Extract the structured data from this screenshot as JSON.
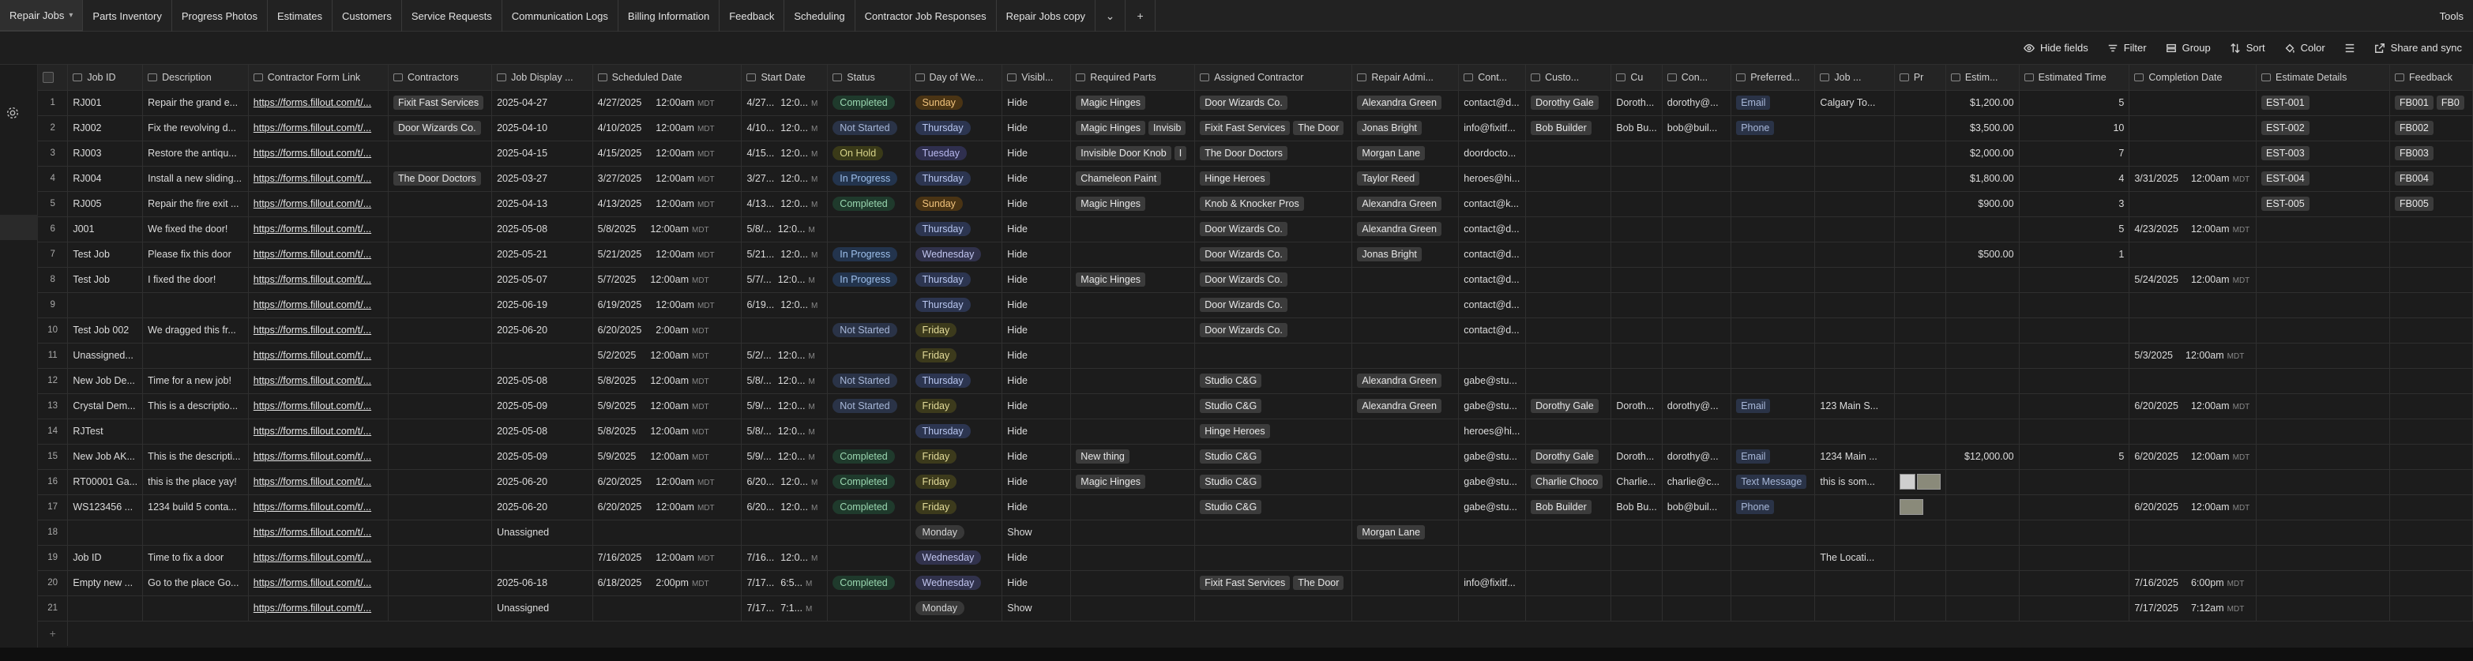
{
  "tabs": [
    "Repair Jobs",
    "Parts Inventory",
    "Progress Photos",
    "Estimates",
    "Customers",
    "Service Requests",
    "Communication Logs",
    "Billing Information",
    "Feedback",
    "Scheduling",
    "Contractor Job Responses",
    "Repair Jobs copy"
  ],
  "tools_label": "Tools",
  "toolbar": {
    "hide_fields": "Hide fields",
    "filter": "Filter",
    "group": "Group",
    "sort": "Sort",
    "color": "Color",
    "share": "Share and sync"
  },
  "columns": [
    "Job ID",
    "Description",
    "Contractor Form Link",
    "Contractors",
    "Job Display ...",
    "Scheduled Date",
    "Start Date",
    "Status",
    "Day of We...",
    "Visibl...",
    "Required Parts",
    "Assigned Contractor",
    "Repair Admi...",
    "Cont...",
    "Custo...",
    "Cu",
    "Con...",
    "Preferred...",
    "Job ...",
    "Pr",
    "Estim...",
    "Estimated Time",
    "Completion Date",
    "Estimate Details",
    "Feedback"
  ],
  "tz": "MDT",
  "add_row": "+",
  "rows": [
    {
      "n": "1",
      "id": "RJ001",
      "desc": "Repair the grand e...",
      "link": "https://forms.fillout.com/t/...",
      "contractors": [
        "Fixit Fast Services"
      ],
      "disp": "2025-04-27",
      "sd": "4/27/2025",
      "st": "12:00am",
      "stz": true,
      "sdd": "4/27...",
      "stt": "12:0...",
      "status": "Completed",
      "sc": "completed",
      "day": "Sunday",
      "dc": "sunday",
      "vis": "Hide",
      "parts": [
        "Magic Hinges"
      ],
      "ac": [
        "Door Wizards Co."
      ],
      "adm": [
        "Alexandra Green"
      ],
      "cont": "contact@d...",
      "cust": [
        "Dorothy Gale"
      ],
      "cu": "Doroth...",
      "con": "dorothy@...",
      "pref": "Email",
      "job": "Calgary To...",
      "pr": "",
      "est": "$1,200.00",
      "et": "5",
      "cd": "",
      "ct": "",
      "ed": [
        "EST-001"
      ],
      "fb": [
        "FB001",
        "FB0"
      ]
    },
    {
      "n": "2",
      "id": "RJ002",
      "desc": "Fix the revolving d...",
      "link": "https://forms.fillout.com/t/...",
      "contractors": [
        "Door Wizards Co."
      ],
      "disp": "2025-04-10",
      "sd": "4/10/2025",
      "st": "12:00am",
      "stz": true,
      "sdd": "4/10...",
      "stt": "12:0...",
      "status": "Not Started",
      "sc": "notstarted",
      "day": "Thursday",
      "dc": "thursday",
      "vis": "Hide",
      "parts": [
        "Magic Hinges",
        "Invisib"
      ],
      "ac": [
        "Fixit Fast Services",
        "The Door"
      ],
      "adm": [
        "Jonas Bright"
      ],
      "cont": "info@fixitf...",
      "cust": [
        "Bob Builder"
      ],
      "cu": "Bob Bu...",
      "con": "bob@buil...",
      "pref": "Phone",
      "job": "",
      "pr": "",
      "est": "$3,500.00",
      "et": "10",
      "cd": "",
      "ct": "",
      "ed": [
        "EST-002"
      ],
      "fb": [
        "FB002"
      ]
    },
    {
      "n": "3",
      "id": "RJ003",
      "desc": "Restore the antiqu...",
      "link": "https://forms.fillout.com/t/...",
      "contractors": [],
      "disp": "2025-04-15",
      "sd": "4/15/2025",
      "st": "12:00am",
      "stz": true,
      "sdd": "4/15...",
      "stt": "12:0...",
      "status": "On Hold",
      "sc": "onhold",
      "day": "Tuesday",
      "dc": "tuesday",
      "vis": "Hide",
      "parts": [
        "Invisible Door Knob",
        "I"
      ],
      "ac": [
        "The Door Doctors"
      ],
      "adm": [
        "Morgan Lane"
      ],
      "cont": "doordocto...",
      "cust": [],
      "cu": "",
      "con": "",
      "pref": "",
      "job": "",
      "pr": "",
      "est": "$2,000.00",
      "et": "7",
      "cd": "",
      "ct": "",
      "ed": [
        "EST-003"
      ],
      "fb": [
        "FB003"
      ]
    },
    {
      "n": "4",
      "id": "RJ004",
      "desc": "Install a new sliding...",
      "link": "https://forms.fillout.com/t/...",
      "contractors": [
        "The Door Doctors"
      ],
      "disp": "2025-03-27",
      "sd": "3/27/2025",
      "st": "12:00am",
      "stz": true,
      "sdd": "3/27...",
      "stt": "12:0...",
      "status": "In Progress",
      "sc": "inprogress",
      "day": "Thursday",
      "dc": "thursday",
      "vis": "Hide",
      "parts": [
        "Chameleon Paint"
      ],
      "ac": [
        "Hinge Heroes"
      ],
      "adm": [
        "Taylor Reed"
      ],
      "cont": "heroes@hi...",
      "cust": [],
      "cu": "",
      "con": "",
      "pref": "",
      "job": "",
      "pr": "",
      "est": "$1,800.00",
      "et": "4",
      "cd": "3/31/2025",
      "ct": "12:00am",
      "ed": [
        "EST-004"
      ],
      "fb": [
        "FB004"
      ]
    },
    {
      "n": "5",
      "id": "RJ005",
      "desc": "Repair the fire exit ...",
      "link": "https://forms.fillout.com/t/...",
      "contractors": [],
      "disp": "2025-04-13",
      "sd": "4/13/2025",
      "st": "12:00am",
      "stz": true,
      "sdd": "4/13...",
      "stt": "12:0...",
      "status": "Completed",
      "sc": "completed",
      "day": "Sunday",
      "dc": "sunday",
      "vis": "Hide",
      "parts": [
        "Magic Hinges"
      ],
      "ac": [
        "Knob & Knocker Pros"
      ],
      "adm": [
        "Alexandra Green"
      ],
      "cont": "contact@k...",
      "cust": [],
      "cu": "",
      "con": "",
      "pref": "",
      "job": "",
      "pr": "",
      "est": "$900.00",
      "et": "3",
      "cd": "",
      "ct": "",
      "ed": [
        "EST-005"
      ],
      "fb": [
        "FB005"
      ]
    },
    {
      "n": "6",
      "id": "J001",
      "desc": "We fixed the door!",
      "link": "https://forms.fillout.com/t/...",
      "contractors": [],
      "disp": "2025-05-08",
      "sd": "5/8/2025",
      "st": "12:00am",
      "stz": true,
      "sdd": "5/8/...",
      "stt": "12:0...",
      "status": "",
      "sc": "",
      "day": "Thursday",
      "dc": "thursday",
      "vis": "Hide",
      "parts": [],
      "ac": [
        "Door Wizards Co."
      ],
      "adm": [
        "Alexandra Green"
      ],
      "cont": "contact@d...",
      "cust": [],
      "cu": "",
      "con": "",
      "pref": "",
      "job": "",
      "pr": "",
      "est": "",
      "et": "5",
      "cd": "4/23/2025",
      "ct": "12:00am",
      "ed": [],
      "fb": []
    },
    {
      "n": "7",
      "id": "Test Job",
      "desc": "Please fix this door",
      "link": "https://forms.fillout.com/t/...",
      "contractors": [],
      "disp": "2025-05-21",
      "sd": "5/21/2025",
      "st": "12:00am",
      "stz": true,
      "sdd": "5/21...",
      "stt": "12:0...",
      "status": "In Progress",
      "sc": "inprogress",
      "day": "Wednesday",
      "dc": "wednesday",
      "vis": "Hide",
      "parts": [],
      "ac": [
        "Door Wizards Co."
      ],
      "adm": [
        "Jonas Bright"
      ],
      "cont": "contact@d...",
      "cust": [],
      "cu": "",
      "con": "",
      "pref": "",
      "job": "",
      "pr": "",
      "est": "$500.00",
      "et": "1",
      "cd": "",
      "ct": "",
      "ed": [],
      "fb": []
    },
    {
      "n": "8",
      "id": "Test Job",
      "desc": "I fixed the door!",
      "link": "https://forms.fillout.com/t/...",
      "contractors": [],
      "disp": "2025-05-07",
      "sd": "5/7/2025",
      "st": "12:00am",
      "stz": true,
      "sdd": "5/7/...",
      "stt": "12:0...",
      "status": "In Progress",
      "sc": "inprogress",
      "day": "Thursday",
      "dc": "thursday",
      "vis": "Hide",
      "parts": [
        "Magic Hinges"
      ],
      "ac": [
        "Door Wizards Co."
      ],
      "adm": [],
      "cont": "contact@d...",
      "cust": [],
      "cu": "",
      "con": "",
      "pref": "",
      "job": "",
      "pr": "",
      "est": "",
      "et": "",
      "cd": "5/24/2025",
      "ct": "12:00am",
      "ed": [],
      "fb": []
    },
    {
      "n": "9",
      "id": "",
      "desc": "",
      "link": "https://forms.fillout.com/t/...",
      "contractors": [],
      "disp": "2025-06-19",
      "sd": "6/19/2025",
      "st": "12:00am",
      "stz": true,
      "sdd": "6/19...",
      "stt": "12:0...",
      "status": "",
      "sc": "",
      "day": "Thursday",
      "dc": "thursday",
      "vis": "Hide",
      "parts": [],
      "ac": [
        "Door Wizards Co."
      ],
      "adm": [],
      "cont": "contact@d...",
      "cust": [],
      "cu": "",
      "con": "",
      "pref": "",
      "job": "",
      "pr": "",
      "est": "",
      "et": "",
      "cd": "",
      "ct": "",
      "ed": [],
      "fb": []
    },
    {
      "n": "10",
      "id": "Test Job 002",
      "desc": "We dragged this fr...",
      "link": "https://forms.fillout.com/t/...",
      "contractors": [],
      "disp": "2025-06-20",
      "sd": "6/20/2025",
      "st": "2:00am",
      "stz": true,
      "sdd": "",
      "stt": "",
      "status": "Not Started",
      "sc": "notstarted",
      "day": "Friday",
      "dc": "friday",
      "vis": "Hide",
      "parts": [],
      "ac": [
        "Door Wizards Co."
      ],
      "adm": [],
      "cont": "contact@d...",
      "cust": [],
      "cu": "",
      "con": "",
      "pref": "",
      "job": "",
      "pr": "",
      "est": "",
      "et": "",
      "cd": "",
      "ct": "",
      "ed": [],
      "fb": []
    },
    {
      "n": "11",
      "id": "Unassigned...",
      "desc": "",
      "link": "https://forms.fillout.com/t/...",
      "contractors": [],
      "disp": "",
      "sd": "5/2/2025",
      "st": "12:00am",
      "stz": true,
      "sdd": "5/2/...",
      "stt": "12:0...",
      "status": "",
      "sc": "",
      "day": "Friday",
      "dc": "friday",
      "vis": "Hide",
      "parts": [],
      "ac": [],
      "adm": [],
      "cont": "",
      "cust": [],
      "cu": "",
      "con": "",
      "pref": "",
      "job": "",
      "pr": "",
      "est": "",
      "et": "",
      "cd": "5/3/2025",
      "ct": "12:00am",
      "ed": [],
      "fb": []
    },
    {
      "n": "12",
      "id": "New Job De...",
      "desc": "Time for a new job!",
      "link": "https://forms.fillout.com/t/...",
      "contractors": [],
      "disp": "2025-05-08",
      "sd": "5/8/2025",
      "st": "12:00am",
      "stz": true,
      "sdd": "5/8/...",
      "stt": "12:0...",
      "status": "Not Started",
      "sc": "notstarted",
      "day": "Thursday",
      "dc": "thursday",
      "vis": "Hide",
      "parts": [],
      "ac": [
        "Studio C&G"
      ],
      "adm": [
        "Alexandra Green"
      ],
      "cont": "gabe@stu...",
      "cust": [],
      "cu": "",
      "con": "",
      "pref": "",
      "job": "",
      "pr": "",
      "est": "",
      "et": "",
      "cd": "",
      "ct": "",
      "ed": [],
      "fb": []
    },
    {
      "n": "13",
      "id": "Crystal Dem...",
      "desc": "This is a descriptio...",
      "link": "https://forms.fillout.com/t/...",
      "contractors": [],
      "disp": "2025-05-09",
      "sd": "5/9/2025",
      "st": "12:00am",
      "stz": true,
      "sdd": "5/9/...",
      "stt": "12:0...",
      "status": "Not Started",
      "sc": "notstarted",
      "day": "Friday",
      "dc": "friday",
      "vis": "Hide",
      "parts": [],
      "ac": [
        "Studio C&G"
      ],
      "adm": [
        "Alexandra Green"
      ],
      "cont": "gabe@stu...",
      "cust": [
        "Dorothy Gale"
      ],
      "cu": "Doroth...",
      "con": "dorothy@...",
      "pref": "Email",
      "job": "123 Main S...",
      "pr": "",
      "est": "",
      "et": "",
      "cd": "6/20/2025",
      "ct": "12:00am",
      "ed": [],
      "fb": []
    },
    {
      "n": "14",
      "id": "RJTest",
      "desc": "",
      "link": "https://forms.fillout.com/t/...",
      "contractors": [],
      "disp": "2025-05-08",
      "sd": "5/8/2025",
      "st": "12:00am",
      "stz": true,
      "sdd": "5/8/...",
      "stt": "12:0...",
      "status": "",
      "sc": "",
      "day": "Thursday",
      "dc": "thursday",
      "vis": "Hide",
      "parts": [],
      "ac": [
        "Hinge Heroes"
      ],
      "adm": [],
      "cont": "heroes@hi...",
      "cust": [],
      "cu": "",
      "con": "",
      "pref": "",
      "job": "",
      "pr": "",
      "est": "",
      "et": "",
      "cd": "",
      "ct": "",
      "ed": [],
      "fb": []
    },
    {
      "n": "15",
      "id": "New Job AK...",
      "desc": "This is the descripti...",
      "link": "https://forms.fillout.com/t/...",
      "contractors": [],
      "disp": "2025-05-09",
      "sd": "5/9/2025",
      "st": "12:00am",
      "stz": true,
      "sdd": "5/9/...",
      "stt": "12:0...",
      "status": "Completed",
      "sc": "completed",
      "day": "Friday",
      "dc": "friday",
      "vis": "Hide",
      "parts": [
        "New thing"
      ],
      "ac": [
        "Studio C&G"
      ],
      "adm": [],
      "cont": "gabe@stu...",
      "cust": [
        "Dorothy Gale"
      ],
      "cu": "Doroth...",
      "con": "dorothy@...",
      "pref": "Email",
      "job": "1234 Main ...",
      "pr": "",
      "est": "$12,000.00",
      "et": "5",
      "cd": "6/20/2025",
      "ct": "12:00am",
      "ed": [],
      "fb": []
    },
    {
      "n": "16",
      "id": "RT00001 Ga...",
      "desc": "this is the place yay!",
      "link": "https://forms.fillout.com/t/...",
      "contractors": [],
      "disp": "2025-06-20",
      "sd": "6/20/2025",
      "st": "12:00am",
      "stz": true,
      "sdd": "6/20...",
      "stt": "12:0...",
      "status": "Completed",
      "sc": "completed",
      "day": "Friday",
      "dc": "friday",
      "vis": "Hide",
      "parts": [
        "Magic Hinges"
      ],
      "ac": [
        "Studio C&G"
      ],
      "adm": [],
      "cont": "gabe@stu...",
      "cust": [
        "Charlie Choco"
      ],
      "cu": "Charlie...",
      "con": "charlie@c...",
      "pref": "Text Message",
      "job": "this is som...",
      "pr": "img",
      "est": "",
      "et": "",
      "cd": "",
      "ct": "",
      "ed": [],
      "fb": []
    },
    {
      "n": "17",
      "id": "WS123456 ...",
      "desc": "1234 build 5 conta...",
      "link": "https://forms.fillout.com/t/...",
      "contractors": [],
      "disp": "2025-06-20",
      "sd": "6/20/2025",
      "st": "12:00am",
      "stz": true,
      "sdd": "6/20...",
      "stt": "12:0...",
      "status": "Completed",
      "sc": "completed",
      "day": "Friday",
      "dc": "friday",
      "vis": "Hide",
      "parts": [],
      "ac": [
        "Studio C&G"
      ],
      "adm": [],
      "cont": "gabe@stu...",
      "cust": [
        "Bob Builder"
      ],
      "cu": "Bob Bu...",
      "con": "bob@buil...",
      "pref": "Phone",
      "job": "",
      "pr": "img2",
      "est": "",
      "et": "",
      "cd": "6/20/2025",
      "ct": "12:00am",
      "ed": [],
      "fb": []
    },
    {
      "n": "18",
      "id": "",
      "desc": "",
      "link": "https://forms.fillout.com/t/...",
      "contractors": [],
      "disp": "Unassigned",
      "sd": "",
      "st": "",
      "stz": false,
      "sdd": "",
      "stt": "",
      "status": "",
      "sc": "",
      "day": "Monday",
      "dc": "monday",
      "vis": "Show",
      "parts": [],
      "ac": [],
      "adm": [
        "Morgan Lane"
      ],
      "cont": "",
      "cust": [],
      "cu": "",
      "con": "",
      "pref": "",
      "job": "",
      "pr": "",
      "est": "",
      "et": "",
      "cd": "",
      "ct": "",
      "ed": [],
      "fb": []
    },
    {
      "n": "19",
      "id": "Job ID",
      "desc": "Time to fix a door",
      "link": "https://forms.fillout.com/t/...",
      "contractors": [],
      "disp": "",
      "sd": "7/16/2025",
      "st": "12:00am",
      "stz": true,
      "sdd": "7/16...",
      "stt": "12:0...",
      "status": "",
      "sc": "",
      "day": "Wednesday",
      "dc": "wednesday",
      "vis": "Hide",
      "parts": [],
      "ac": [],
      "adm": [],
      "cont": "",
      "cust": [],
      "cu": "",
      "con": "",
      "pref": "",
      "job": "The Locati...",
      "pr": "",
      "est": "",
      "et": "",
      "cd": "",
      "ct": "",
      "ed": [],
      "fb": []
    },
    {
      "n": "20",
      "id": "Empty new ...",
      "desc": "Go to the place Go...",
      "link": "https://forms.fillout.com/t/...",
      "contractors": [],
      "disp": "2025-06-18",
      "sd": "6/18/2025",
      "st": "2:00pm",
      "stz": true,
      "sdd": "7/17...",
      "stt": "6:5...",
      "status": "Completed",
      "sc": "completed",
      "day": "Wednesday",
      "dc": "wednesday",
      "vis": "Hide",
      "parts": [],
      "ac": [
        "Fixit Fast Services",
        "The Door"
      ],
      "adm": [],
      "cont": "info@fixitf...",
      "cust": [],
      "cu": "",
      "con": "",
      "pref": "",
      "job": "",
      "pr": "",
      "est": "",
      "et": "",
      "cd": "7/16/2025",
      "ct": "6:00pm",
      "ed": [],
      "fb": []
    },
    {
      "n": "21",
      "id": "",
      "desc": "",
      "link": "https://forms.fillout.com/t/...",
      "contractors": [],
      "disp": "Unassigned",
      "sd": "",
      "st": "",
      "stz": false,
      "sdd": "7/17...",
      "stt": "7:1...",
      "status": "",
      "sc": "",
      "day": "Monday",
      "dc": "monday",
      "vis": "Show",
      "parts": [],
      "ac": [],
      "adm": [],
      "cont": "",
      "cust": [],
      "cu": "",
      "con": "",
      "pref": "",
      "job": "",
      "pr": "",
      "est": "",
      "et": "",
      "cd": "7/17/2025",
      "ct": "7:12am",
      "ed": [],
      "fb": []
    }
  ]
}
